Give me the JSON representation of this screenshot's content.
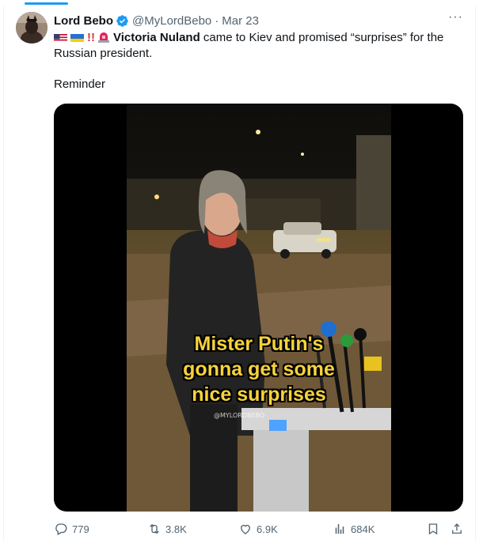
{
  "tweet": {
    "author_name": "Lord Bebo",
    "handle": "@MyLordBebo",
    "separator": "·",
    "date": "Mar 23",
    "more_label": "···",
    "body_exclaim": "!!",
    "body_name": "Victoria Nuland",
    "body_rest": " came to Kiev and promised “surprises” for the Russian president.",
    "reminder": "Reminder"
  },
  "video": {
    "caption_line1": "Mister Putin's",
    "caption_line2": "gonna get some",
    "caption_line3": "nice surprises",
    "watermark": "@MYLORDBEBO"
  },
  "actions": {
    "replies": "779",
    "retweets": "3.8K",
    "likes": "6.9K",
    "views": "684K"
  },
  "icons": [
    "verified-badge-icon",
    "us-flag-icon",
    "ukraine-flag-icon",
    "siren-icon",
    "reply-icon",
    "retweet-icon",
    "like-icon",
    "views-icon",
    "bookmark-icon",
    "share-icon",
    "more-icon"
  ],
  "colors": {
    "accent": "#1d9bf0",
    "muted": "#536471",
    "caption": "#f7d23b"
  }
}
